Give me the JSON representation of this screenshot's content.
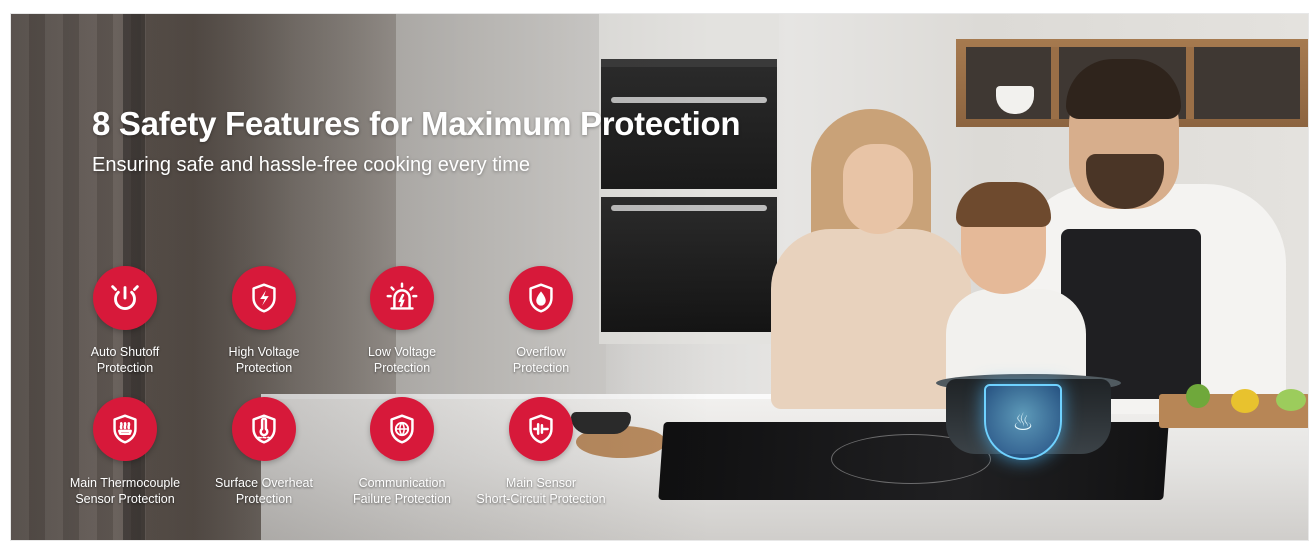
{
  "headline": "8 Safety Features for Maximum Protection",
  "subheadline": "Ensuring safe and hassle-free cooking every time",
  "accent_color": "#d7193a",
  "features": [
    {
      "line1": "Auto Shutoff",
      "line2": "Protection",
      "icon": "power-icon"
    },
    {
      "line1": "High Voltage",
      "line2": "Protection",
      "icon": "lightning-shield-icon"
    },
    {
      "line1": "Low Voltage",
      "line2": "Protection",
      "icon": "alarm-siren-icon"
    },
    {
      "line1": "Overflow",
      "line2": "Protection",
      "icon": "water-drop-shield-icon"
    },
    {
      "line1": "Main Thermocouple",
      "line2": "Sensor Protection",
      "icon": "heat-shield-icon"
    },
    {
      "line1": "Surface Overheat",
      "line2": "Protection",
      "icon": "thermometer-shield-icon"
    },
    {
      "line1": "Communication",
      "line2": "Failure Protection",
      "icon": "globe-shield-icon"
    },
    {
      "line1": "Main Sensor",
      "line2": "Short-Circuit Protection",
      "icon": "circuit-shield-icon"
    }
  ]
}
